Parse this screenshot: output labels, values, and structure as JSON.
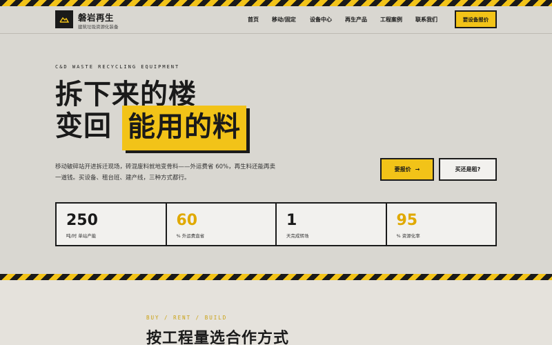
{
  "brand": {
    "name": "磐岩再生",
    "tagline": "建筑垃圾资源化装备"
  },
  "nav": {
    "items": [
      {
        "label": "首页"
      },
      {
        "label": "移动/固定"
      },
      {
        "label": "设备中心"
      },
      {
        "label": "再生产品"
      },
      {
        "label": "工程案例"
      },
      {
        "label": "联系我们"
      }
    ],
    "quote_button": "要设备报价"
  },
  "hero": {
    "eyebrow": "C&D WASTE RECYCLING EQUIPMENT",
    "headline_line1": "拆下来的楼",
    "headline_line2": "变回",
    "headline_highlight": "能用的料",
    "description": "移动破碎站开进拆迁现场，砖混废料就地变骨料——外运费省 60%，再生料还能再卖一道钱。买设备、租台班、建产线，三种方式都行。",
    "primary_button": "要报价",
    "primary_arrow": "→",
    "secondary_button": "买还是租?"
  },
  "stats": [
    {
      "value": "250",
      "label": "吨/时 单站产能",
      "accent": false
    },
    {
      "value": "60",
      "label": "% 外运费直省",
      "accent": true
    },
    {
      "value": "1",
      "label": "天完成转场",
      "accent": false
    },
    {
      "value": "95",
      "label": "% 资源化率",
      "accent": true
    }
  ],
  "section2": {
    "eyebrow": "BUY / RENT / BUILD",
    "title": "按工程量选合作方式"
  },
  "colors": {
    "accent": "#f2c318",
    "ink": "#1a1a1a",
    "background": "#d9d7d1"
  }
}
